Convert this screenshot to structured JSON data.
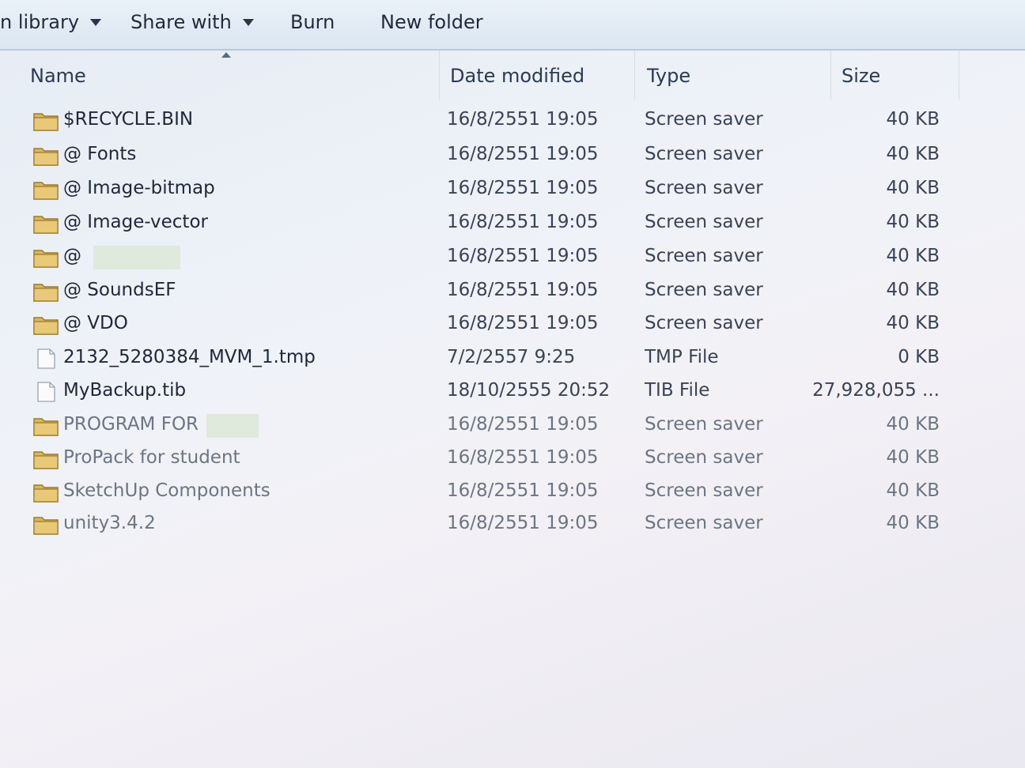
{
  "toolbar": {
    "include_library": "n library",
    "share_with": "Share with",
    "burn": "Burn",
    "new_folder": "New folder"
  },
  "columns": {
    "name": "Name",
    "date": "Date modified",
    "type": "Type",
    "size": "Size"
  },
  "files": [
    {
      "name": "$RECYCLE.BIN",
      "date": "16/8/2551 19:05",
      "type": "Screen saver",
      "size": "40 KB",
      "icon": "folder-icon"
    },
    {
      "name": "@ Fonts",
      "date": "16/8/2551 19:05",
      "type": "Screen saver",
      "size": "40 KB",
      "icon": "folder-icon"
    },
    {
      "name": "@ Image-bitmap",
      "date": "16/8/2551 19:05",
      "type": "Screen saver",
      "size": "40 KB",
      "icon": "folder-icon"
    },
    {
      "name": "@ Image-vector",
      "date": "16/8/2551 19:05",
      "type": "Screen saver",
      "size": "40 KB",
      "icon": "folder-icon"
    },
    {
      "name": "@",
      "date": "16/8/2551 19:05",
      "type": "Screen saver",
      "size": "40 KB",
      "icon": "folder-icon",
      "redacted": true
    },
    {
      "name": "@ SoundsEF",
      "date": "16/8/2551 19:05",
      "type": "Screen saver",
      "size": "40 KB",
      "icon": "folder-icon"
    },
    {
      "name": "@ VDO",
      "date": "16/8/2551 19:05",
      "type": "Screen saver",
      "size": "40 KB",
      "icon": "folder-icon"
    },
    {
      "name": "2132_5280384_MVM_1.tmp",
      "date": "7/2/2557 9:25",
      "type": "TMP File",
      "size": "0 KB",
      "icon": "file-icon"
    },
    {
      "name": "MyBackup.tib",
      "date": "18/10/2555 20:52",
      "type": "TIB File",
      "size": "27,928,055 ...",
      "icon": "file-icon"
    },
    {
      "name": "PROGRAM FOR",
      "date": "16/8/2551 19:05",
      "type": "Screen saver",
      "size": "40 KB",
      "icon": "folder-icon",
      "redacted": true
    },
    {
      "name": "ProPack for student",
      "date": "16/8/2551 19:05",
      "type": "Screen saver",
      "size": "40 KB",
      "icon": "folder-icon"
    },
    {
      "name": "SketchUp Components",
      "date": "16/8/2551 19:05",
      "type": "Screen saver",
      "size": "40 KB",
      "icon": "folder-icon"
    },
    {
      "name": "unity3.4.2",
      "date": "16/8/2551 19:05",
      "type": "Screen saver",
      "size": "40 KB",
      "icon": "folder-icon"
    }
  ]
}
